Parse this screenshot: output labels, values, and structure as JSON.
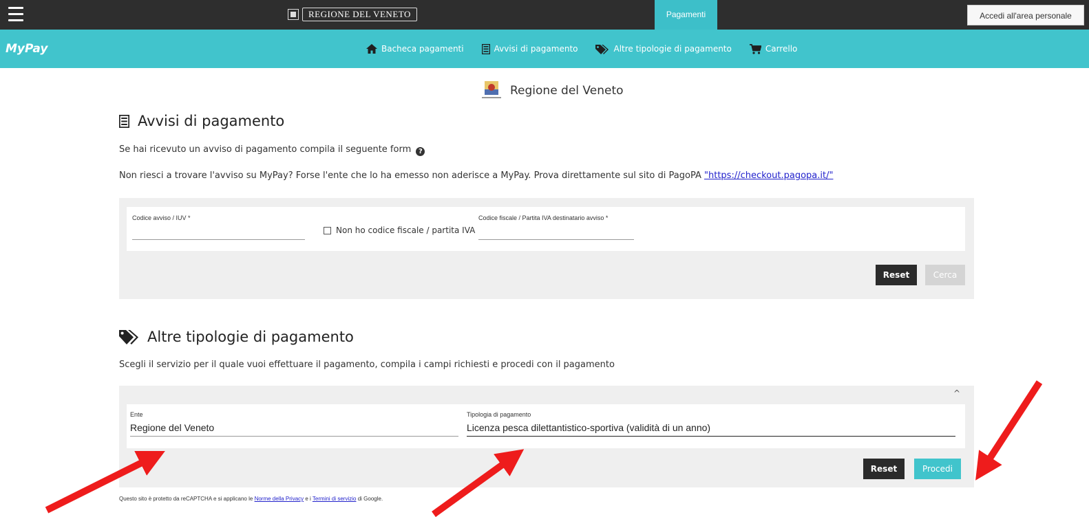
{
  "topbar": {
    "brand": "REGIONE DEL VENETO",
    "active_tab": "Pagamenti",
    "login_label": "Accedi all'area personale"
  },
  "navbar": {
    "logo": "MyPay",
    "items": [
      {
        "label": "Bacheca pagamenti",
        "icon": "home-icon"
      },
      {
        "label": "Avvisi di pagamento",
        "icon": "document-icon"
      },
      {
        "label": "Altre tipologie di pagamento",
        "icon": "tags-icon"
      },
      {
        "label": "Carrello",
        "icon": "cart-icon"
      }
    ]
  },
  "ente": {
    "name": "Regione del Veneto"
  },
  "avvisi": {
    "title": "Avvisi di pagamento",
    "intro": "Se hai ricevuto un avviso di pagamento compila il seguente form",
    "notice_text": "Non riesci a trovare l'avviso su MyPay? Forse l'ente che lo ha emesso non aderisce a MyPay. Prova direttamente sul sito di PagoPA",
    "notice_link": "\"https://checkout.pagopa.it/\"",
    "iuv_label": "Codice avviso / IUV *",
    "iuv_value": "",
    "checkbox_label": "Non ho codice fiscale / partita IVA",
    "cf_label": "Codice fiscale / Partita IVA destinatario avviso *",
    "cf_value": "",
    "reset_label": "Reset",
    "search_label": "Cerca"
  },
  "altre": {
    "title": "Altre tipologie di pagamento",
    "intro": "Scegli il servizio per il quale vuoi effettuare il pagamento, compila i campi richiesti e procedi con il pagamento",
    "ente_label": "Ente",
    "ente_value": "Regione del Veneto",
    "tipologia_label": "Tipologia di pagamento",
    "tipologia_value": "Licenza pesca dilettantistico-sportiva (validità di un anno)",
    "reset_label": "Reset",
    "proceed_label": "Procedi"
  },
  "footer": {
    "text_before": "Questo sito è protetto da reCAPTCHA e si applicano le",
    "privacy_link": "Norme della Privacy",
    "text_middle": "e i",
    "terms_link": "Termini di servizio",
    "text_after": "di Google."
  },
  "colors": {
    "topbar": "#2e2e2e",
    "accent": "#41c4cc",
    "panel": "#efefef",
    "annotation_arrow": "#ee1c1c"
  }
}
